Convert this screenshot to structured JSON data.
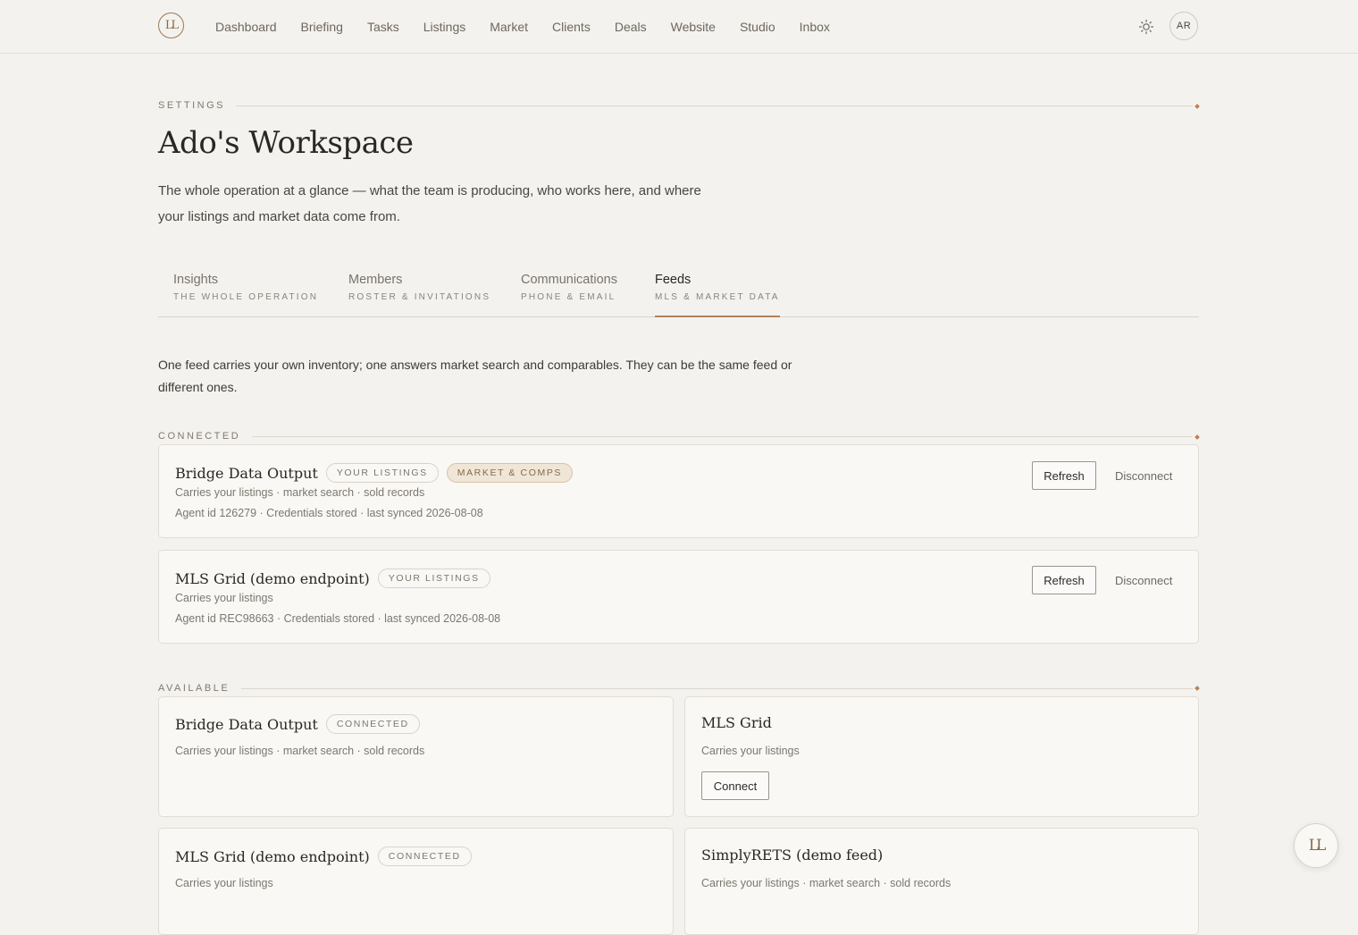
{
  "nav": {
    "logo": "LL",
    "items": [
      "Dashboard",
      "Briefing",
      "Tasks",
      "Listings",
      "Market",
      "Clients",
      "Deals",
      "Website",
      "Studio",
      "Inbox"
    ],
    "avatar": "AR"
  },
  "header": {
    "eyebrow": "SETTINGS",
    "title": "Ado's Workspace",
    "subtitle": "The whole operation at a glance — what the team is producing, who works here, and where your listings and market data come from."
  },
  "tabs": [
    {
      "label": "Insights",
      "sub": "THE WHOLE OPERATION"
    },
    {
      "label": "Members",
      "sub": "ROSTER & INVITATIONS"
    },
    {
      "label": "Communications",
      "sub": "PHONE & EMAIL"
    },
    {
      "label": "Feeds",
      "sub": "MLS & MARKET DATA"
    }
  ],
  "intro": "One feed carries your own inventory; one answers market search and comparables. They can be the same feed or different ones.",
  "connected": {
    "label": "CONNECTED",
    "feeds": [
      {
        "name": "Bridge Data Output",
        "badges": [
          "YOUR LISTINGS",
          "MARKET & COMPS"
        ],
        "carries": "Carries your listings · market search · sold records",
        "details": "Agent id 126279 · Credentials stored · last synced 2026-08-08",
        "refresh": "Refresh",
        "disconnect": "Disconnect"
      },
      {
        "name": "MLS Grid (demo endpoint)",
        "badges": [
          "YOUR LISTINGS"
        ],
        "carries": "Carries your listings",
        "details": "Agent id REC98663 · Credentials stored · last synced 2026-08-08",
        "refresh": "Refresh",
        "disconnect": "Disconnect"
      }
    ]
  },
  "available": {
    "label": "AVAILABLE",
    "feeds": [
      {
        "name": "Bridge Data Output",
        "badge": "CONNECTED",
        "carries": "Carries your listings · market search · sold records"
      },
      {
        "name": "MLS Grid",
        "carries": "Carries your listings",
        "connect": "Connect"
      },
      {
        "name": "MLS Grid (demo endpoint)",
        "badge": "CONNECTED",
        "carries": "Carries your listings"
      },
      {
        "name": "SimplyRETS (demo feed)",
        "carries": "Carries your listings · market search · sold records"
      }
    ]
  },
  "fab": "LL"
}
